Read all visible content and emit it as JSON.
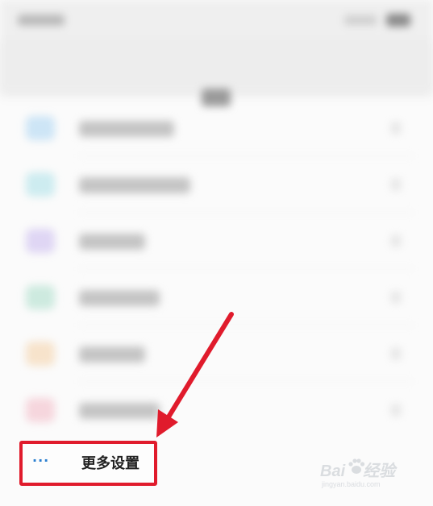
{
  "more_settings": {
    "icon": "more-dots-icon",
    "dots": "···",
    "label": "更多设置"
  },
  "highlight_color": "#e01b2c",
  "list_rows": [
    {
      "icon_color": "#a8d4f2"
    },
    {
      "icon_color": "#a8e0e8"
    },
    {
      "icon_color": "#c9b8ee"
    },
    {
      "icon_color": "#a8dcc8"
    },
    {
      "icon_color": "#f4cfa4"
    },
    {
      "icon_color": "#f2b8c4"
    }
  ],
  "watermark": {
    "brand": "Bai",
    "brand2": "经验",
    "url": "jingyan.baidu.com"
  }
}
